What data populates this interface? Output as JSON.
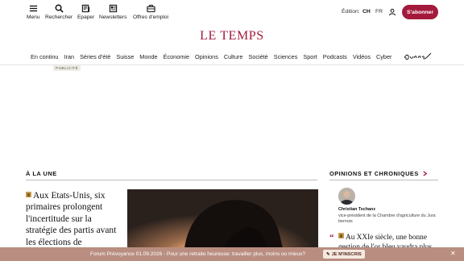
{
  "toolbar": {
    "menu": "Menu",
    "search": "Rechercher",
    "epaper": "Epaper",
    "newsletters": "Newsletters",
    "jobs": "Offres d'emploi"
  },
  "edition": {
    "label": "Édition:",
    "ch": "CH",
    "fr": "FR"
  },
  "subscribe_label": "S'abonner",
  "logo_text": "LE TEMPS",
  "nav": [
    "En continu",
    "Iran",
    "Séries d'été",
    "Suisse",
    "Monde",
    "Économie",
    "Opinions",
    "Culture",
    "Société",
    "Sciences",
    "Sport",
    "Podcasts",
    "Vidéos",
    "Cyber"
  ],
  "ad_label": "PUBLICITÉ",
  "headlines_section": "À LA UNE",
  "opinions_section": "OPINIONS ET CHRONIQUES",
  "main_headline": "Aux Etats-Unis, six primaires prolongent l'incertitude sur la stratégie des partis avant les élections de",
  "opinion": {
    "author": "Christian Tschanz",
    "role": "vice-président de la Chambre d'agriculture du Jura bernois",
    "title": "Au XXIe siècle, une bonne gestion de l'or bleu vaudra plus"
  },
  "banner": {
    "text": "Forum Prévoyance 01.09.2026 - Pour une retraite heureuse: travailler plus, moins ou mieux?",
    "button": "JE M'INSCRIS",
    "close": "✕"
  },
  "colors": {
    "brand": "#a31a3c",
    "banner": "#b98e80",
    "premium": "#c79a4a"
  },
  "icons": [
    "menu-icon",
    "search-icon",
    "epaper-icon",
    "newsletter-icon",
    "briefcase-icon",
    "user-icon",
    "chevron-right-icon",
    "premium-icon"
  ]
}
